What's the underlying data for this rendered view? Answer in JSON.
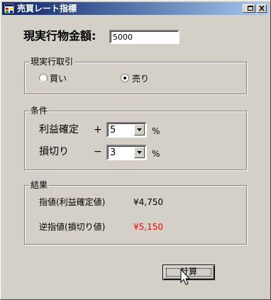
{
  "window": {
    "title": "売買レート指標"
  },
  "amount": {
    "label": "現実行物金額:",
    "value": "5000"
  },
  "trade_group": {
    "legend": "現実行取引",
    "options": [
      {
        "label": "買い",
        "selected": false
      },
      {
        "label": "売り",
        "selected": true
      }
    ]
  },
  "conditions_group": {
    "legend": "条件",
    "rows": [
      {
        "label": "利益確定",
        "sign": "+",
        "value": "5",
        "unit": "%"
      },
      {
        "label": "損切り",
        "sign": "−",
        "value": "3",
        "unit": "%"
      }
    ]
  },
  "results_group": {
    "legend": "結果",
    "rows": [
      {
        "label": "指値(利益確定値)",
        "value": "¥4,750",
        "color": "#000000"
      },
      {
        "label": "逆指値(損切り値)",
        "value": "¥5,150",
        "color": "#ff0000"
      }
    ]
  },
  "calc_button": {
    "label": "計算"
  }
}
